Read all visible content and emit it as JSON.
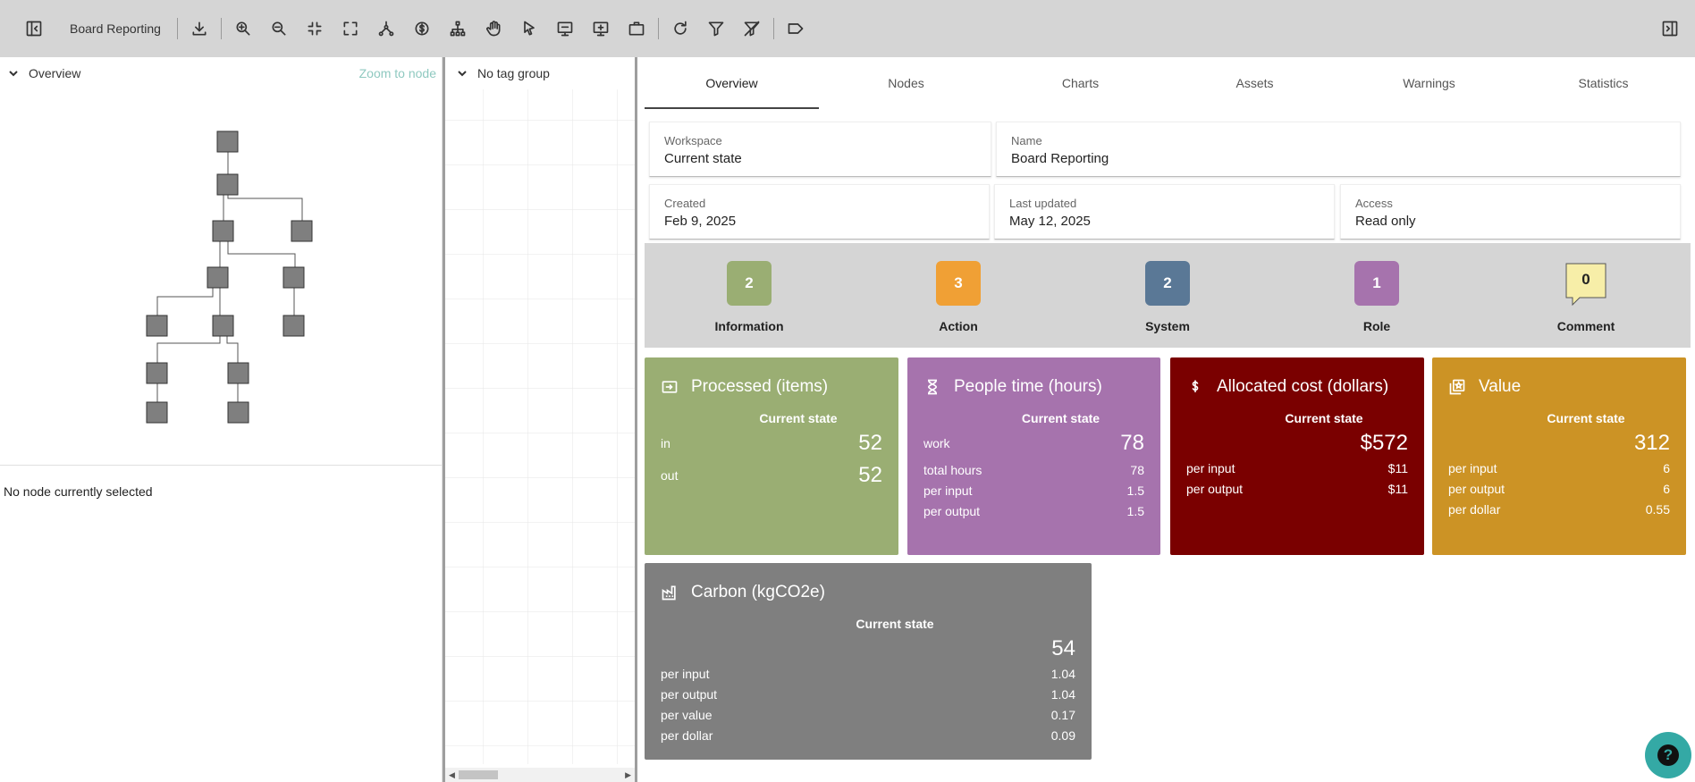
{
  "toolbar": {
    "title": "Board Reporting",
    "icons": [
      "sidebar-toggle-left-icon",
      "download-icon",
      "zoom-in-icon",
      "zoom-out-icon",
      "fit-icon",
      "fullscreen-icon",
      "connect-icon",
      "cost-icon",
      "hierarchy-icon",
      "pan-hand-icon",
      "pointer-icon",
      "present-icon",
      "add-screen-icon",
      "briefcase-icon",
      "refresh-icon",
      "filter-icon",
      "clear-filter-icon",
      "tag-icon",
      "sidebar-toggle-right-icon"
    ]
  },
  "left": {
    "header": "Overview",
    "zoom_link": "Zoom to node",
    "no_node": "No node currently selected"
  },
  "middle": {
    "header": "No tag group"
  },
  "tabs": [
    "Overview",
    "Nodes",
    "Charts",
    "Assets",
    "Warnings",
    "Statistics"
  ],
  "fields": {
    "workspace_label": "Workspace",
    "workspace_value": "Current state",
    "name_label": "Name",
    "name_value": "Board Reporting",
    "created_label": "Created",
    "created_value": "Feb 9, 2025",
    "updated_label": "Last updated",
    "updated_value": "May 12, 2025",
    "access_label": "Access",
    "access_value": "Read only"
  },
  "badges": [
    {
      "count": "2",
      "label": "Information",
      "color": "#9aae73"
    },
    {
      "count": "3",
      "label": "Action",
      "color": "#f0a035"
    },
    {
      "count": "2",
      "label": "System",
      "color": "#5a7896"
    },
    {
      "count": "1",
      "label": "Role",
      "color": "#a673ad"
    },
    {
      "count": "0",
      "label": "Comment",
      "color": "#f7eea8"
    }
  ],
  "cards": {
    "processed": {
      "title": "Processed (items)",
      "color": "#9aae73",
      "subtitle": "Current state",
      "rows": [
        {
          "label": "in",
          "value": "52"
        },
        {
          "label": "out",
          "value": "52"
        }
      ]
    },
    "people": {
      "title": "People time (hours)",
      "color": "#a673ad",
      "subtitle": "Current state",
      "rows": [
        {
          "label": "work",
          "value": "78"
        },
        {
          "label": "total hours",
          "value": "78"
        },
        {
          "label": "per input",
          "value": "1.5"
        },
        {
          "label": "per output",
          "value": "1.5"
        }
      ]
    },
    "cost": {
      "title": "Allocated cost (dollars)",
      "color": "#7a0000",
      "subtitle": "Current state",
      "big": "$572",
      "rows": [
        {
          "label": "per input",
          "value": "$11"
        },
        {
          "label": "per output",
          "value": "$11"
        }
      ]
    },
    "value": {
      "title": "Value",
      "color": "#cc9325",
      "subtitle": "Current state",
      "big": "312",
      "rows": [
        {
          "label": "per input",
          "value": "6"
        },
        {
          "label": "per output",
          "value": "6"
        },
        {
          "label": "per dollar",
          "value": "0.55"
        }
      ]
    },
    "carbon": {
      "title": "Carbon (kgCO2e)",
      "color": "#7f7f7f",
      "subtitle": "Current state",
      "big": "54",
      "rows": [
        {
          "label": "per input",
          "value": "1.04"
        },
        {
          "label": "per output",
          "value": "1.04"
        },
        {
          "label": "per value",
          "value": "0.17"
        },
        {
          "label": "per dollar",
          "value": "0.09"
        }
      ]
    }
  },
  "help": {
    "symbol": "?"
  }
}
